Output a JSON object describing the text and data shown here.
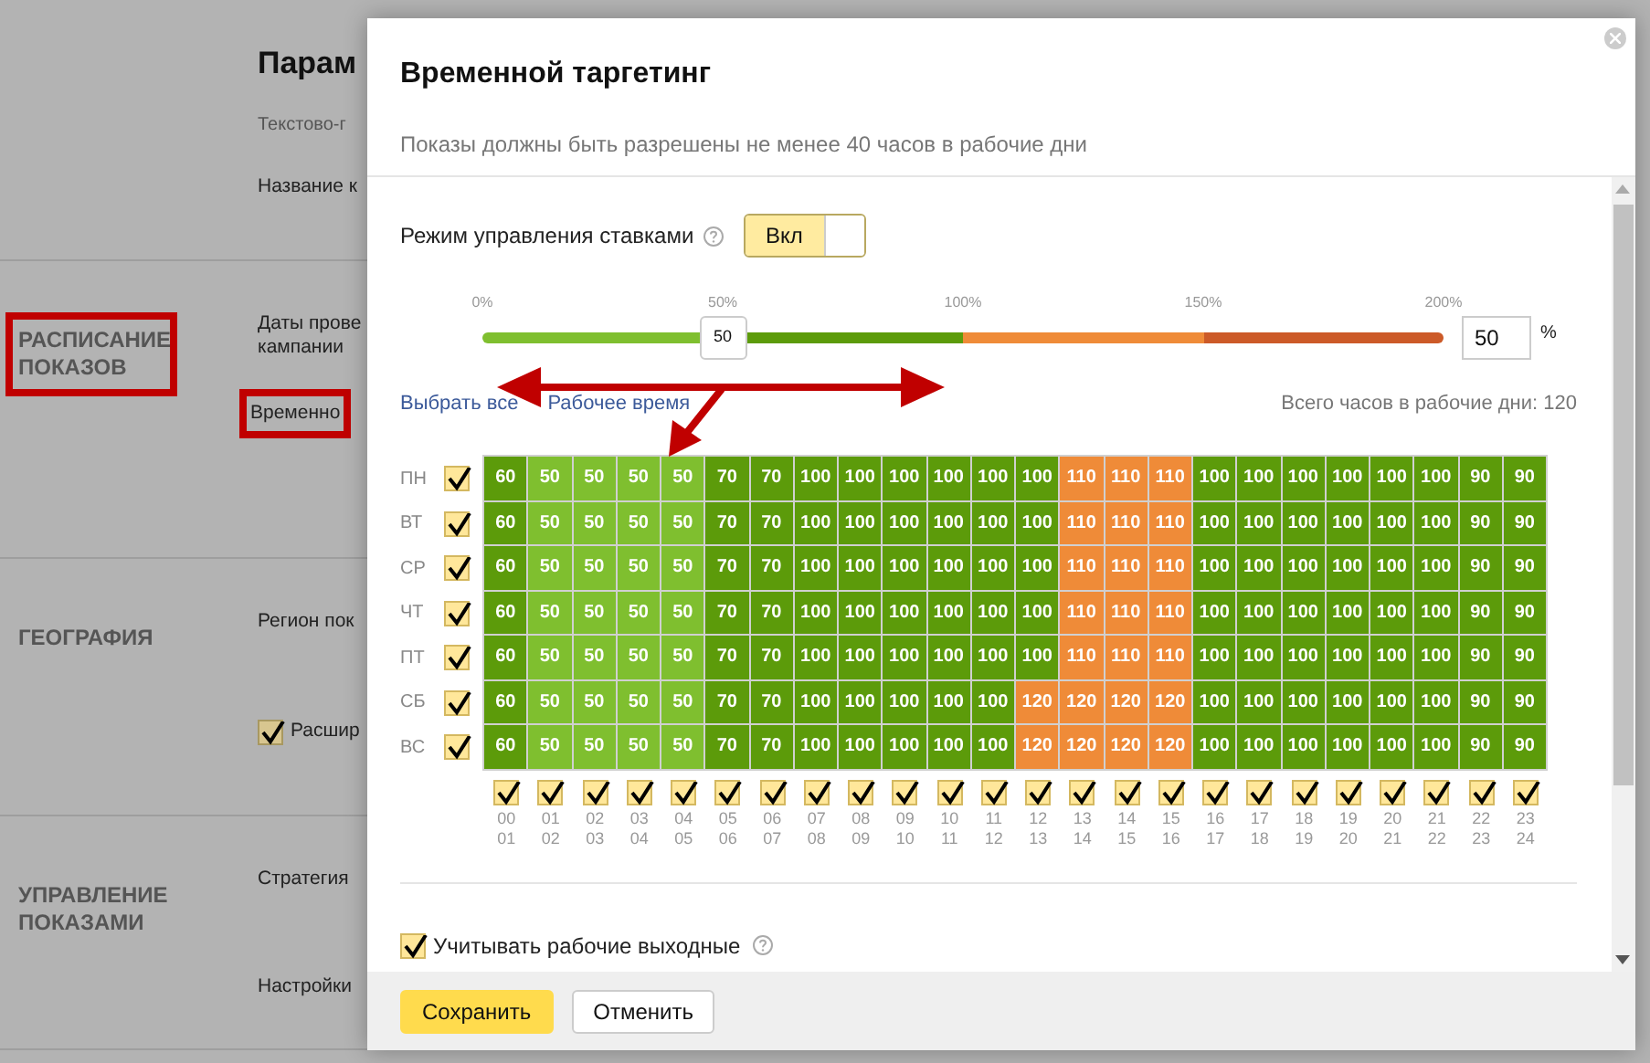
{
  "background_page": {
    "title": "Парам",
    "subtitle": "Текстово-г",
    "fields_top": [
      "Название к"
    ],
    "sections": [
      {
        "heading": "РАСПИСАНИЕ ПОКАЗОВ",
        "highlighted": true,
        "rows": [
          {
            "kind": "text",
            "label": "Даты прове\nкампании"
          },
          {
            "kind": "framed_text",
            "label": "Временно"
          }
        ]
      },
      {
        "heading": "ГЕОГРАФИЯ",
        "highlighted": false,
        "rows": [
          {
            "kind": "text",
            "label": "Регион пок"
          },
          {
            "kind": "checkbox",
            "label": "Расшир",
            "checked": true
          }
        ]
      },
      {
        "heading": "УПРАВЛЕНИЕ ПОКАЗАМИ",
        "highlighted": false,
        "rows": [
          {
            "kind": "text",
            "label": "Стратегия"
          },
          {
            "kind": "text",
            "label": "Настройки"
          }
        ]
      }
    ]
  },
  "dialog": {
    "title": "Временной таргетинг",
    "subtitle": "Показы должны быть разрешены не менее 40 часов в рабочие дни",
    "bid_mode": {
      "label": "Режим управления ставками",
      "toggle_label": "Вкл",
      "on": true
    },
    "slider": {
      "ticks": [
        "0%",
        "50%",
        "100%",
        "150%",
        "200%"
      ],
      "thumb_label": "50",
      "level": 0.25,
      "input_value": "50",
      "unit": "%"
    },
    "links": [
      "Выбрать все",
      "Рабочее время"
    ],
    "total_hours": "Всего часов в рабочие дни: 120",
    "days": [
      {
        "label": "ПН",
        "checked": true,
        "values": [
          "60",
          "50",
          "50",
          "50",
          "50",
          "70",
          "70",
          "100",
          "100",
          "100",
          "100",
          "100",
          "100",
          "110",
          "110",
          "110",
          "100",
          "100",
          "100",
          "100",
          "100",
          "100",
          "90",
          "90"
        ]
      },
      {
        "label": "ВТ",
        "checked": true,
        "values": [
          "60",
          "50",
          "50",
          "50",
          "50",
          "70",
          "70",
          "100",
          "100",
          "100",
          "100",
          "100",
          "100",
          "110",
          "110",
          "110",
          "100",
          "100",
          "100",
          "100",
          "100",
          "100",
          "90",
          "90"
        ]
      },
      {
        "label": "СР",
        "checked": true,
        "values": [
          "60",
          "50",
          "50",
          "50",
          "50",
          "70",
          "70",
          "100",
          "100",
          "100",
          "100",
          "100",
          "100",
          "110",
          "110",
          "110",
          "100",
          "100",
          "100",
          "100",
          "100",
          "100",
          "90",
          "90"
        ]
      },
      {
        "label": "ЧТ",
        "checked": true,
        "values": [
          "60",
          "50",
          "50",
          "50",
          "50",
          "70",
          "70",
          "100",
          "100",
          "100",
          "100",
          "100",
          "100",
          "110",
          "110",
          "110",
          "100",
          "100",
          "100",
          "100",
          "100",
          "100",
          "90",
          "90"
        ]
      },
      {
        "label": "ПТ",
        "checked": true,
        "values": [
          "60",
          "50",
          "50",
          "50",
          "50",
          "70",
          "70",
          "100",
          "100",
          "100",
          "100",
          "100",
          "100",
          "110",
          "110",
          "110",
          "100",
          "100",
          "100",
          "100",
          "100",
          "100",
          "90",
          "90"
        ]
      },
      {
        "label": "СБ",
        "checked": true,
        "values": [
          "60",
          "50",
          "50",
          "50",
          "50",
          "70",
          "70",
          "100",
          "100",
          "100",
          "100",
          "100",
          "120",
          "120",
          "120",
          "120",
          "100",
          "100",
          "100",
          "100",
          "100",
          "100",
          "90",
          "90"
        ]
      },
      {
        "label": "ВС",
        "checked": true,
        "values": [
          "60",
          "50",
          "50",
          "50",
          "50",
          "70",
          "70",
          "100",
          "100",
          "100",
          "100",
          "100",
          "120",
          "120",
          "120",
          "120",
          "100",
          "100",
          "100",
          "100",
          "100",
          "100",
          "90",
          "90"
        ]
      }
    ],
    "hours": [
      {
        "label": "00\n01",
        "checked": true
      },
      {
        "label": "01\n02",
        "checked": true
      },
      {
        "label": "02\n03",
        "checked": true
      },
      {
        "label": "03\n04",
        "checked": true
      },
      {
        "label": "04\n05",
        "checked": true
      },
      {
        "label": "05\n06",
        "checked": true
      },
      {
        "label": "06\n07",
        "checked": true
      },
      {
        "label": "07\n08",
        "checked": true
      },
      {
        "label": "08\n09",
        "checked": true
      },
      {
        "label": "09\n10",
        "checked": true
      },
      {
        "label": "10\n11",
        "checked": true
      },
      {
        "label": "11\n12",
        "checked": true
      },
      {
        "label": "12\n13",
        "checked": true
      },
      {
        "label": "13\n14",
        "checked": true
      },
      {
        "label": "14\n15",
        "checked": true
      },
      {
        "label": "15\n16",
        "checked": true
      },
      {
        "label": "16\n17",
        "checked": true
      },
      {
        "label": "17\n18",
        "checked": true
      },
      {
        "label": "18\n19",
        "checked": true
      },
      {
        "label": "19\n20",
        "checked": true
      },
      {
        "label": "20\n21",
        "checked": true
      },
      {
        "label": "21\n22",
        "checked": true
      },
      {
        "label": "22\n23",
        "checked": true
      },
      {
        "label": "23\n24",
        "checked": true
      }
    ],
    "working_weekends": {
      "label": "Учитывать рабочие выходные",
      "checked": true
    },
    "buttons": [
      {
        "label": "Сохранить",
        "kind": "primary"
      },
      {
        "label": "Отменить",
        "kind": "secondary"
      }
    ]
  }
}
